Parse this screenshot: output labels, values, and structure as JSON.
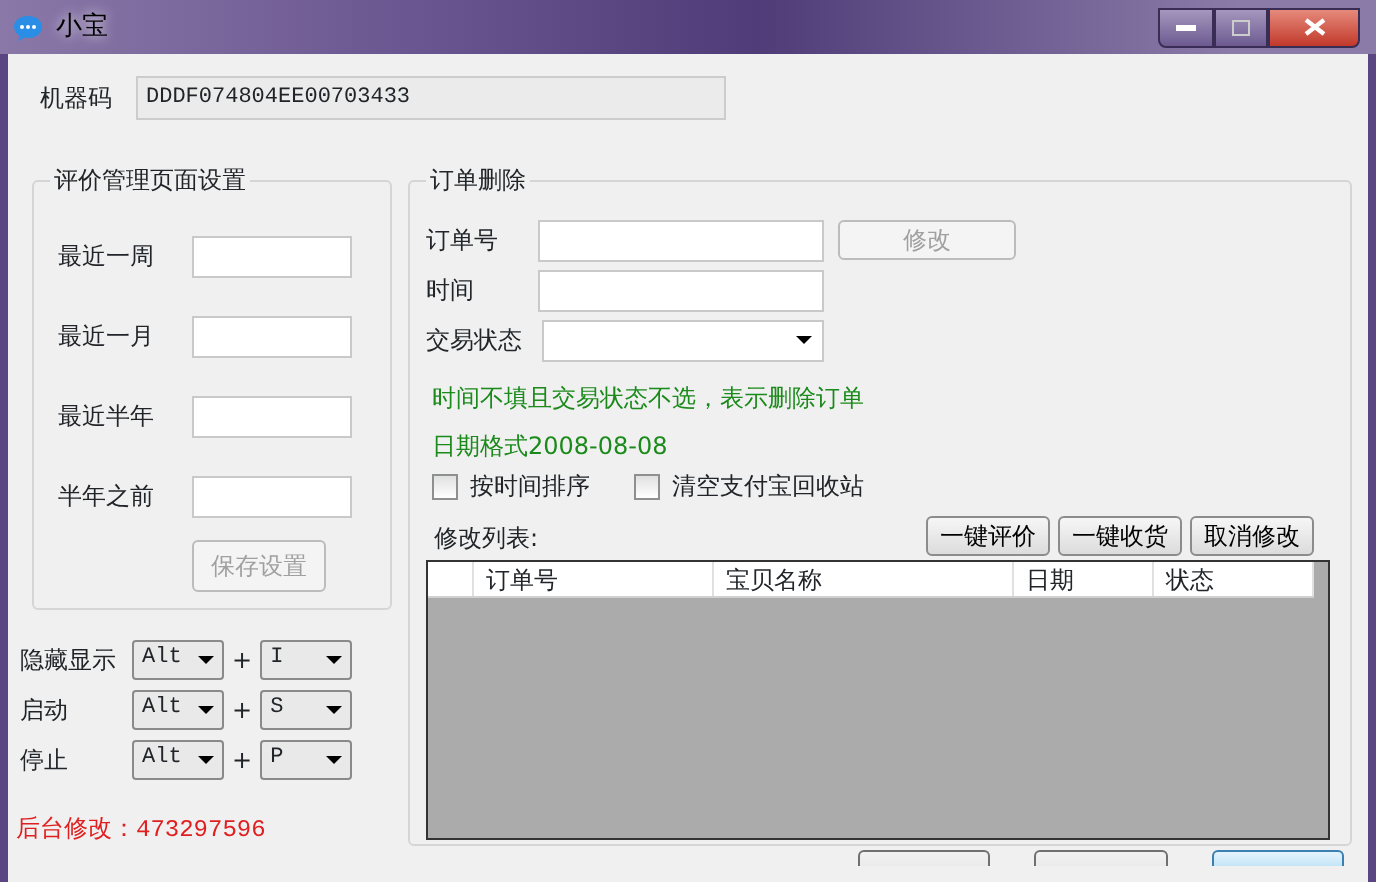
{
  "window": {
    "title": "小宝"
  },
  "machine_code": {
    "label": "机器码",
    "value": "DDDF074804EE00703433"
  },
  "review_settings": {
    "title": "评价管理页面设置",
    "fields": [
      {
        "label": "最近一周"
      },
      {
        "label": "最近一月"
      },
      {
        "label": "最近半年"
      },
      {
        "label": "半年之前"
      }
    ],
    "save_button": {
      "label": "保存设置",
      "disabled": true
    }
  },
  "hotkeys": [
    {
      "label": "隐藏显示",
      "modifier": "Alt",
      "plus": "+",
      "key": "I"
    },
    {
      "label": "启动",
      "modifier": "Alt",
      "plus": "+",
      "key": "S"
    },
    {
      "label": "停止",
      "modifier": "Alt",
      "plus": "+",
      "key": "P"
    }
  ],
  "footer_note": "后台修改：473297596",
  "order_delete": {
    "title": "订单删除",
    "order_no_label": "订单号",
    "modify_button": {
      "label": "修改",
      "disabled": true
    },
    "time_label": "时间",
    "status_label": "交易状态",
    "hints": [
      "时间不填且交易状态不选，表示删除订单",
      "日期格式2008-08-08"
    ],
    "checkboxes": [
      {
        "label": "按时间排序",
        "checked": false
      },
      {
        "label": "清空支付宝回收站",
        "checked": false
      }
    ],
    "list_label": "修改列表:",
    "actions": [
      "一键评价",
      "一键收货",
      "取消修改"
    ],
    "table": {
      "columns": [
        "订单号",
        "宝贝名称",
        "日期",
        "状态"
      ]
    }
  },
  "bottom_buttons": [
    {
      "default": false
    },
    {
      "default": false
    },
    {
      "default": true
    }
  ]
}
